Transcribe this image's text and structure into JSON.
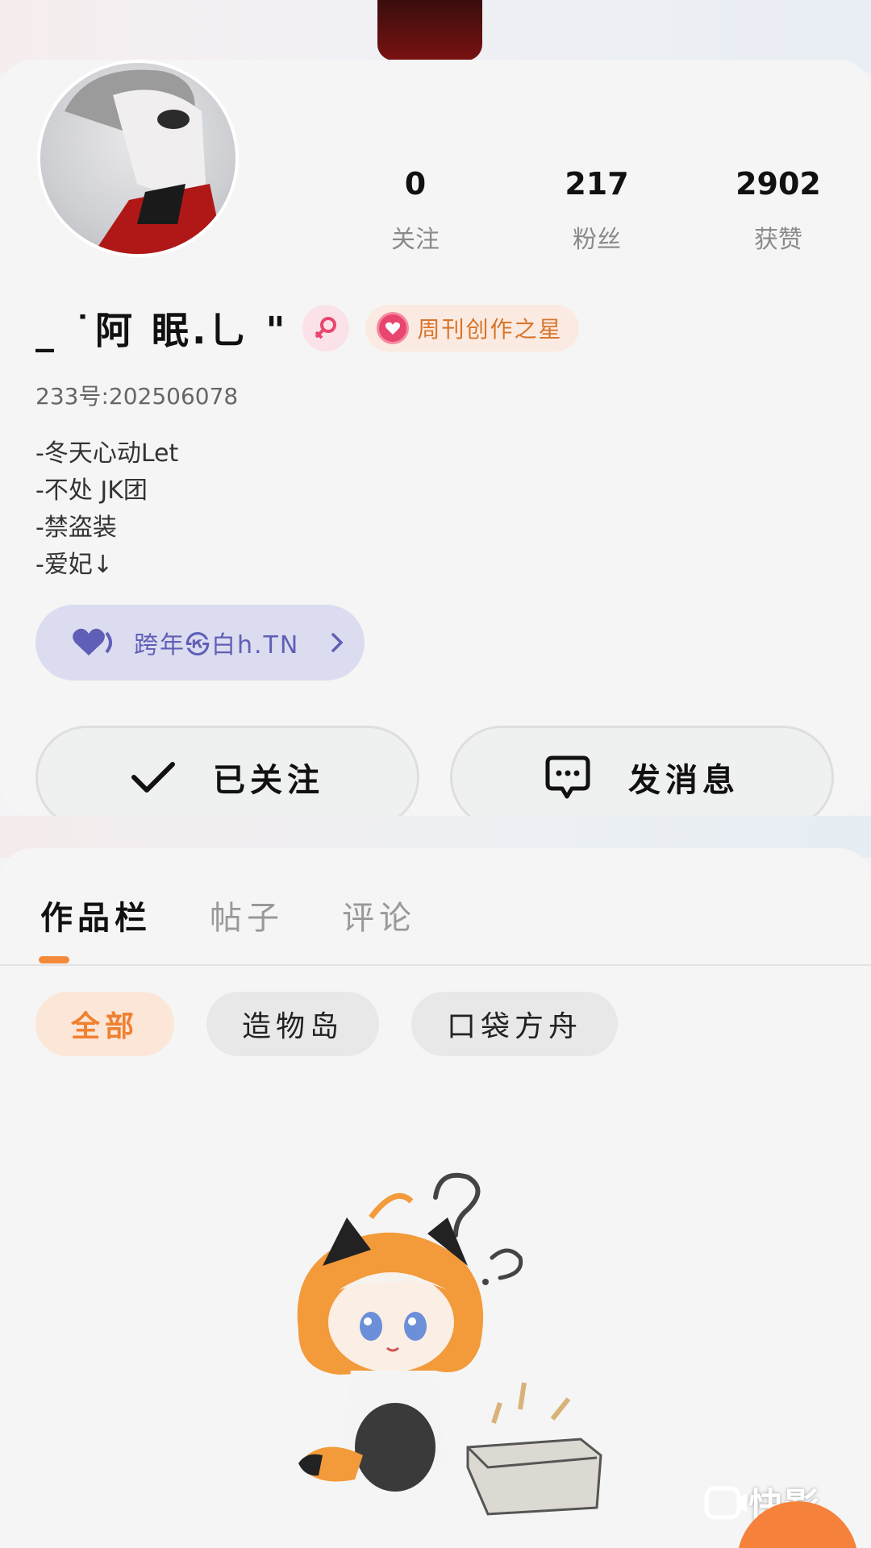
{
  "profile": {
    "username": "_ ˙阿 眠.乚 \"",
    "gender_icon": "female-icon",
    "badge_label": "周刊创作之星",
    "user_id": "233号:202506078",
    "bio": [
      "-冬天心动Let",
      "-不处 JK团",
      "-禁盗装",
      "-爱妃↓"
    ],
    "link_label": "跨年㉿白h.TN"
  },
  "stats": [
    {
      "value": "0",
      "label": "关注"
    },
    {
      "value": "217",
      "label": "粉丝"
    },
    {
      "value": "2902",
      "label": "获赞"
    }
  ],
  "actions": {
    "follow_label": "已关注",
    "message_label": "发消息"
  },
  "tabs": [
    "作品栏",
    "帖子",
    "评论"
  ],
  "filters": [
    "全部",
    "造物岛",
    "口袋方舟"
  ],
  "watermark": "快影",
  "colors": {
    "accent": "#f08030",
    "link": "#5f5fb8",
    "badge": "#d9752a"
  }
}
